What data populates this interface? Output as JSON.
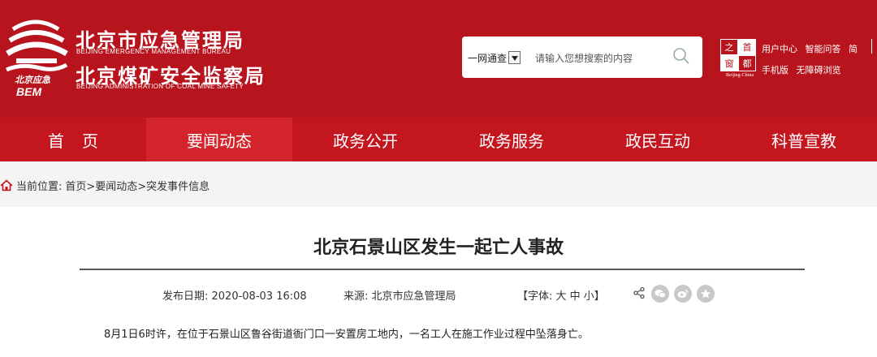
{
  "header": {
    "org_cn_1": "北京市应急管理局",
    "org_en_1": "BEIJING   EMERGENCY MANAGEMENT BUREAU",
    "org_cn_2": "北京煤矿安全监察局",
    "org_en_2": "BEIJING   ADMINISTRATION OF COAL MINE SAFETY",
    "emblem_text": "北京应急",
    "emblem_sub": "BEM"
  },
  "search": {
    "scope": "一网通查",
    "placeholder": "请输入您想搜索的内容"
  },
  "seal": {
    "chars": [
      "之",
      "首",
      "窗",
      "都"
    ],
    "caption": "Beijing-China"
  },
  "toplinks": {
    "row1": [
      "用户中心",
      "智能问答",
      "简"
    ],
    "row2": [
      "手机版",
      "无障碍浏览"
    ]
  },
  "nav": {
    "items": [
      "首页",
      "要闻动态",
      "政务公开",
      "政务服务",
      "政民互动",
      "科普宣教"
    ],
    "active_index": 1
  },
  "breadcrumb": {
    "label": "当前位置:",
    "path": "首页>要闻动态>突发事件信息"
  },
  "article": {
    "title": "北京石景山区发生一起亡人事故",
    "date": "发布日期:  2020-08-03 16:08",
    "source": "来源:  北京市应急管理局",
    "font_size": "【字体:  大 中 小】",
    "body": "8月1日6时许，在位于石景山区鲁谷街道衙门口一安置房工地内，一名工人在施工作业过程中坠落身亡。"
  },
  "colors": {
    "header_red": "#b8141d",
    "nav_red": "#c4161f",
    "nav_active": "#d3232b"
  }
}
